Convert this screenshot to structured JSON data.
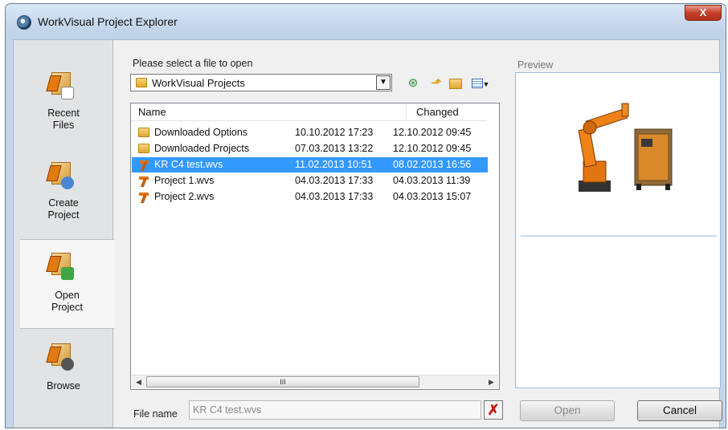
{
  "window": {
    "title": "WorkVisual Project Explorer",
    "close_glyph": "X"
  },
  "sidebar": {
    "items": [
      {
        "label_line1": "Recent",
        "label_line2": "Files",
        "icon": "recent-files-icon",
        "selected": false
      },
      {
        "label_line1": "Create",
        "label_line2": "Project",
        "icon": "create-project-icon",
        "selected": false
      },
      {
        "label_line1": "Open",
        "label_line2": "Project",
        "icon": "open-project-icon",
        "selected": true
      },
      {
        "label_line1": "Browse",
        "label_line2": "",
        "icon": "browse-icon",
        "selected": false
      }
    ]
  },
  "browser": {
    "prompt": "Please select a file to open",
    "location": "WorkVisual Projects",
    "columns": {
      "name": "Name",
      "changed": "Changed"
    },
    "rows": [
      {
        "name": "Downloaded Options",
        "type": "folder",
        "created": "10.10.2012 17:23",
        "changed": "12.10.2012 09:45",
        "selected": false
      },
      {
        "name": "Downloaded Projects",
        "type": "folder",
        "created": "07.03.2013 13:22",
        "changed": "12.10.2012 09:45",
        "selected": false
      },
      {
        "name": "KR C4 test.wvs",
        "type": "wvs",
        "created": "11.02.2013 10:51",
        "changed": "08.02.2013 16:56",
        "selected": true
      },
      {
        "name": "Project 1.wvs",
        "type": "wvs",
        "created": "04.03.2013 17:33",
        "changed": "04.03.2013 11:39",
        "selected": false
      },
      {
        "name": "Project 2.wvs",
        "type": "wvs",
        "created": "04.03.2013 17:33",
        "changed": "04.03.2013 15:07",
        "selected": false
      }
    ],
    "scroll_thumb_glyph": "III"
  },
  "file_name": {
    "label": "File name",
    "value": "KR C4 test.wvs",
    "clear_glyph": "✗"
  },
  "preview": {
    "label": "Preview"
  },
  "buttons": {
    "open": "Open",
    "cancel": "Cancel"
  },
  "colors": {
    "selection": "#3399ff",
    "title_bar": "#c6d7ec",
    "robot_orange": "#e2720f"
  }
}
